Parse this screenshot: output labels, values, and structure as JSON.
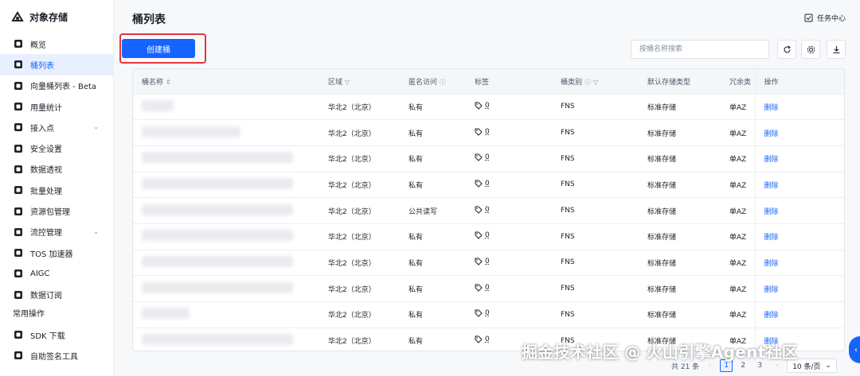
{
  "sidebar": {
    "brand": "对象存储",
    "items": [
      {
        "label": "概览",
        "icon": "overview-icon"
      },
      {
        "label": "桶列表",
        "icon": "bucket-icon",
        "active": true
      },
      {
        "label": "向量桶列表 - Beta",
        "icon": "vector-bucket-icon"
      },
      {
        "label": "用量统计",
        "icon": "usage-icon"
      },
      {
        "label": "接入点",
        "icon": "globe-icon",
        "expandable": true
      },
      {
        "label": "安全设置",
        "icon": "shield-icon"
      },
      {
        "label": "数据透视",
        "icon": "chart-icon"
      },
      {
        "label": "批量处理",
        "icon": "layers-icon"
      },
      {
        "label": "资源包管理",
        "icon": "package-icon"
      },
      {
        "label": "流控管理",
        "icon": "gauge-icon",
        "expandable": true
      },
      {
        "label": "TOS 加速器",
        "icon": "accelerator-icon"
      },
      {
        "label": "AIGC",
        "icon": "aigc-icon"
      },
      {
        "label": "数据订阅",
        "icon": "subscription-icon"
      }
    ],
    "section_label": "常用操作",
    "tools": [
      {
        "label": "SDK 下载",
        "icon": "sdk-icon"
      },
      {
        "label": "自助签名工具",
        "icon": "signature-icon"
      }
    ]
  },
  "header": {
    "title": "桶列表",
    "task_center": "任务中心"
  },
  "toolbar": {
    "create_label": "创建桶",
    "search_placeholder": "按桶名称搜索"
  },
  "table": {
    "columns": {
      "name": "桶名称",
      "region": "区域",
      "anon": "匿名访问",
      "tag": "标签",
      "type": "桶类别",
      "storage": "默认存储类型",
      "redundancy": "冗余类",
      "op": "操作"
    },
    "rows": [
      {
        "region": "华北2（北京）",
        "anon": "私有",
        "tag": "0",
        "type": "FNS",
        "storage": "标准存储",
        "redundancy": "单AZ",
        "op": "删除"
      },
      {
        "region": "华北2（北京）",
        "anon": "私有",
        "tag": "0",
        "type": "FNS",
        "storage": "标准存储",
        "redundancy": "单AZ",
        "op": "删除"
      },
      {
        "region": "华北2（北京）",
        "anon": "私有",
        "tag": "0",
        "type": "FNS",
        "storage": "标准存储",
        "redundancy": "单AZ",
        "op": "删除"
      },
      {
        "region": "华北2（北京）",
        "anon": "私有",
        "tag": "0",
        "type": "FNS",
        "storage": "标准存储",
        "redundancy": "单AZ",
        "op": "删除"
      },
      {
        "region": "华北2（北京）",
        "anon": "公共读写",
        "tag": "0",
        "type": "FNS",
        "storage": "标准存储",
        "redundancy": "单AZ",
        "op": "删除"
      },
      {
        "region": "华北2（北京）",
        "anon": "私有",
        "tag": "0",
        "type": "FNS",
        "storage": "标准存储",
        "redundancy": "单AZ",
        "op": "删除"
      },
      {
        "region": "华北2（北京）",
        "anon": "私有",
        "tag": "0",
        "type": "FNS",
        "storage": "标准存储",
        "redundancy": "单AZ",
        "op": "删除"
      },
      {
        "region": "华北2（北京）",
        "anon": "私有",
        "tag": "0",
        "type": "FNS",
        "storage": "标准存储",
        "redundancy": "单AZ",
        "op": "删除"
      },
      {
        "region": "华北2（北京）",
        "anon": "私有",
        "tag": "0",
        "type": "FNS",
        "storage": "标准存储",
        "redundancy": "单AZ",
        "op": "删除"
      },
      {
        "region": "华北2（北京）",
        "anon": "私有",
        "tag": "0",
        "type": "FNS",
        "storage": "标准存储",
        "redundancy": "单AZ",
        "op": "删除"
      }
    ]
  },
  "pagination": {
    "total": "共 21 条",
    "pages": [
      "1",
      "2",
      "3"
    ],
    "current": "1",
    "page_size": "10 条/页"
  },
  "watermark": "掘金技术社区 @ 火山引擎Agent社区",
  "colors": {
    "accent": "#1664ff",
    "highlight": "#e5353a"
  }
}
